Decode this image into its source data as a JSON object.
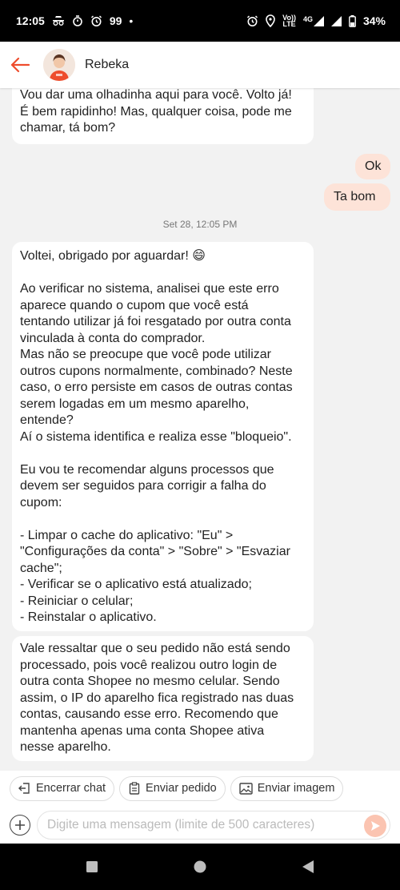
{
  "status_bar": {
    "time": "12:05",
    "notif_count": "99",
    "dot": "•",
    "network_label_top": "Vo))",
    "network_label_bottom": "LTE",
    "network_type": "4G",
    "battery": "34%"
  },
  "header": {
    "agent_name": "Rebeka",
    "back_icon": "arrow-left-icon",
    "accent_color": "#ee4d2d"
  },
  "messages": [
    {
      "direction": "in",
      "text": "Vou dar uma olhadinha aqui para você. Volto já!\nÉ bem rapidinho! Mas, qualquer coisa, pode me\nchamar, tá bom?"
    },
    {
      "direction": "out",
      "text": "Ok"
    },
    {
      "direction": "out",
      "text": "Ta bom"
    },
    {
      "direction": "in",
      "text": "Voltei, obrigado por aguardar! 😄\n\nAo verificar no sistema, analisei que este erro\naparece quando o cupom que você está\ntentando utilizar já foi resgatado por outra conta\nvinculada à conta do comprador.\nMas não se preocupe que você pode utilizar\noutros cupons normalmente, combinado? Neste\ncaso, o erro persiste em casos de outras contas\nserem logadas em um mesmo aparelho,\nentende?\nAí o sistema identifica e realiza esse \"bloqueio\".\n\nEu vou te recomendar alguns processos que\ndevem ser seguidos para corrigir a falha do\ncupom:\n\n- Limpar o cache do aplicativo: \"Eu\" >\n\"Configurações da conta\" > \"Sobre\" > \"Esvaziar\ncache\";\n - Verificar se o aplicativo está atualizado;\n- Reiniciar o celular;\n- Reinstalar o aplicativo."
    },
    {
      "direction": "in",
      "text": "Vale ressaltar que o seu pedido não está sendo\nprocessado, pois você realizou outro login de\noutra conta Shopee no mesmo celular. Sendo\nassim, o IP do aparelho fica registrado nas duas\ncontas, causando esse erro. Recomendo que\nmantenha apenas uma conta Shopee ativa\nnesse aparelho."
    }
  ],
  "timestamp": "Set 28, 12:05 PM",
  "quick_actions": [
    {
      "label": "Encerrar chat",
      "icon": "exit-icon"
    },
    {
      "label": "Enviar pedido",
      "icon": "clipboard-icon"
    },
    {
      "label": "Enviar imagem",
      "icon": "image-icon"
    }
  ],
  "composer": {
    "placeholder": "Digite uma mensagem (limite de 500 caracteres)",
    "send_icon": "send-icon",
    "add_icon": "plus-circle-icon"
  },
  "colors": {
    "outgoing_bubble": "#fde3d8",
    "incoming_bubble": "#ffffff",
    "background": "#f2f2f2",
    "send_button": "#fbc4b1"
  }
}
